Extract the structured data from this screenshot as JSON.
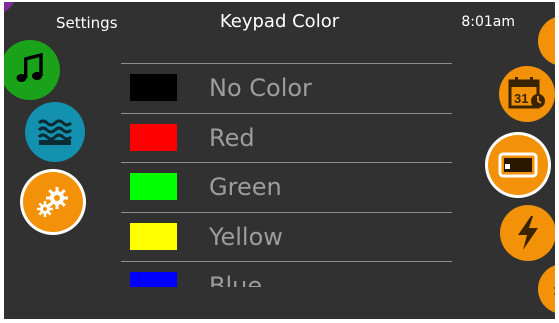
{
  "header": {
    "section": "Settings",
    "title": "Keypad Color",
    "time": "8:01am"
  },
  "left_nav": [
    {
      "name": "music-icon",
      "color": "#1ba21b"
    },
    {
      "name": "water-waves-icon",
      "color": "#1391ae"
    },
    {
      "name": "gears-icon",
      "color": "#f39208"
    }
  ],
  "right_nav": [
    {
      "name": "schedule-calendar-icon",
      "color": "#f39208",
      "calendar_day": "31"
    },
    {
      "name": "display-panel-icon",
      "color": "#f39208",
      "selected": true
    },
    {
      "name": "lightning-icon",
      "color": "#f39208"
    }
  ],
  "colors": [
    {
      "label": "No Color",
      "swatch": "#000000"
    },
    {
      "label": "Red",
      "swatch": "#ff0000"
    },
    {
      "label": "Green",
      "swatch": "#00ff00"
    },
    {
      "label": "Yellow",
      "swatch": "#ffff00"
    },
    {
      "label": "Blue",
      "swatch": "#0000ff"
    }
  ],
  "colors_theme": {
    "screen_bg": "#313131",
    "accent_orange": "#f39208",
    "label_gray": "#9d9d9d"
  }
}
